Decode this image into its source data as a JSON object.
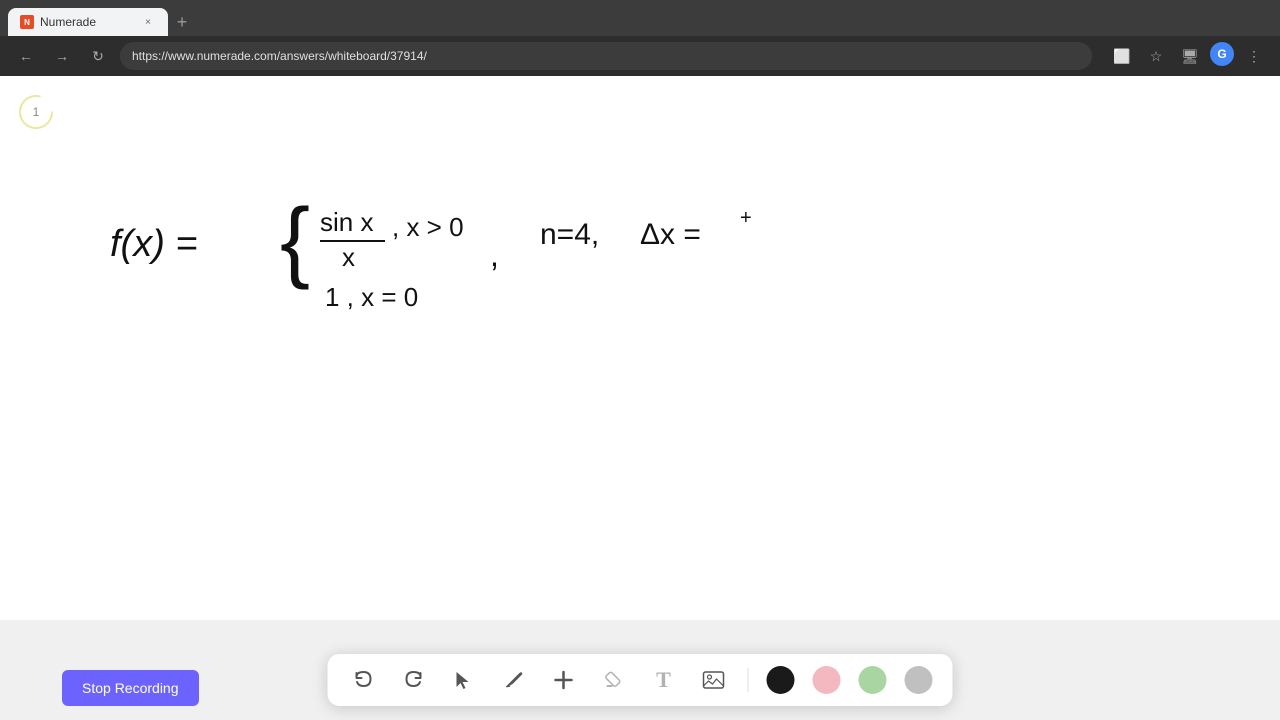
{
  "browser": {
    "tab": {
      "title": "Numerade",
      "favicon_text": "N",
      "close_label": "×",
      "new_tab_label": "+"
    },
    "nav": {
      "back": "←",
      "forward": "→",
      "refresh": "↻"
    },
    "url": "https://www.numerade.com/answers/whiteboard/37914/",
    "actions": {
      "cast": "⬜",
      "bookmark": "☆",
      "display": "🖥",
      "profile": "G",
      "menu": "⋮"
    }
  },
  "whiteboard": {
    "timer_number": "1"
  },
  "toolbar": {
    "undo_label": "↺",
    "redo_label": "↻",
    "select_label": "▲",
    "pen_label": "✏",
    "add_label": "+",
    "highlight_label": "/",
    "text_label": "T",
    "image_label": "🖼",
    "colors": [
      "black",
      "pink",
      "green",
      "gray"
    ]
  },
  "stop_recording": {
    "label": "Stop Recording"
  }
}
